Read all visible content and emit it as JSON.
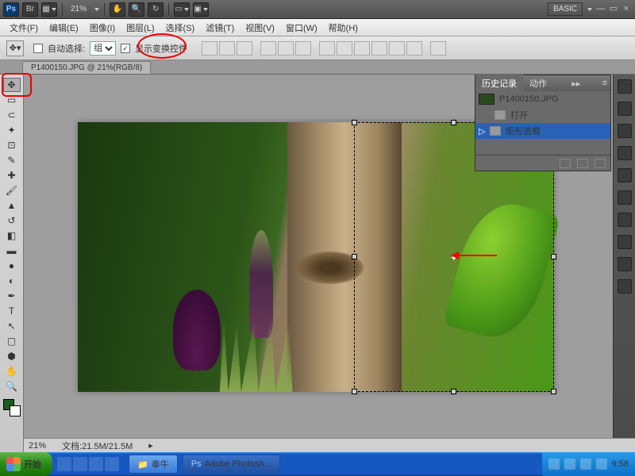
{
  "topbar": {
    "zoom": "21%",
    "workspace_label": "BASIC"
  },
  "menus": [
    "文件(F)",
    "编辑(E)",
    "图像(I)",
    "图层(L)",
    "选择(S)",
    "滤镜(T)",
    "视图(V)",
    "窗口(W)",
    "帮助(H)"
  ],
  "options": {
    "auto_select_label": "自动选择:",
    "group_option": "组",
    "show_transform_label": "显示变换控件"
  },
  "tab": {
    "title": "P1400150.JPG @ 21%(RGB/8)"
  },
  "history": {
    "tab1": "历史记录",
    "tab2": "动作",
    "filename": "P1400150.JPG",
    "items": [
      {
        "label": "打开"
      },
      {
        "label": "矩形选框"
      }
    ]
  },
  "status": {
    "zoom": "21%",
    "doc": "文档:21.5M/21.5M"
  },
  "taskbar": {
    "start": "开始",
    "task1": "奉牛",
    "task2": "Adobe Photosh...",
    "clock": "9:58"
  }
}
